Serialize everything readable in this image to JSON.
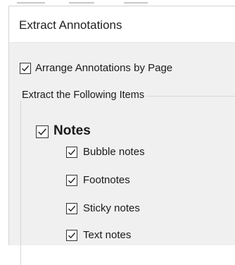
{
  "window": {
    "title": "Extract Annotations"
  },
  "options": {
    "arrange_by_page": {
      "label": "Arrange Annotations by Page",
      "checked": true
    }
  },
  "items_group": {
    "legend": "Extract the Following Items",
    "notes": {
      "label": "Notes",
      "checked": true,
      "children": [
        {
          "label": "Bubble notes",
          "checked": true
        },
        {
          "label": "Footnotes",
          "checked": true
        },
        {
          "label": "Sticky notes",
          "checked": true
        },
        {
          "label": "Text notes",
          "checked": true
        }
      ]
    }
  },
  "colors": {
    "dialog_background": "#f0f0f0",
    "titlebar_background": "#ffffff",
    "checkbox_border": "#333333",
    "check_mark": "#222222"
  }
}
